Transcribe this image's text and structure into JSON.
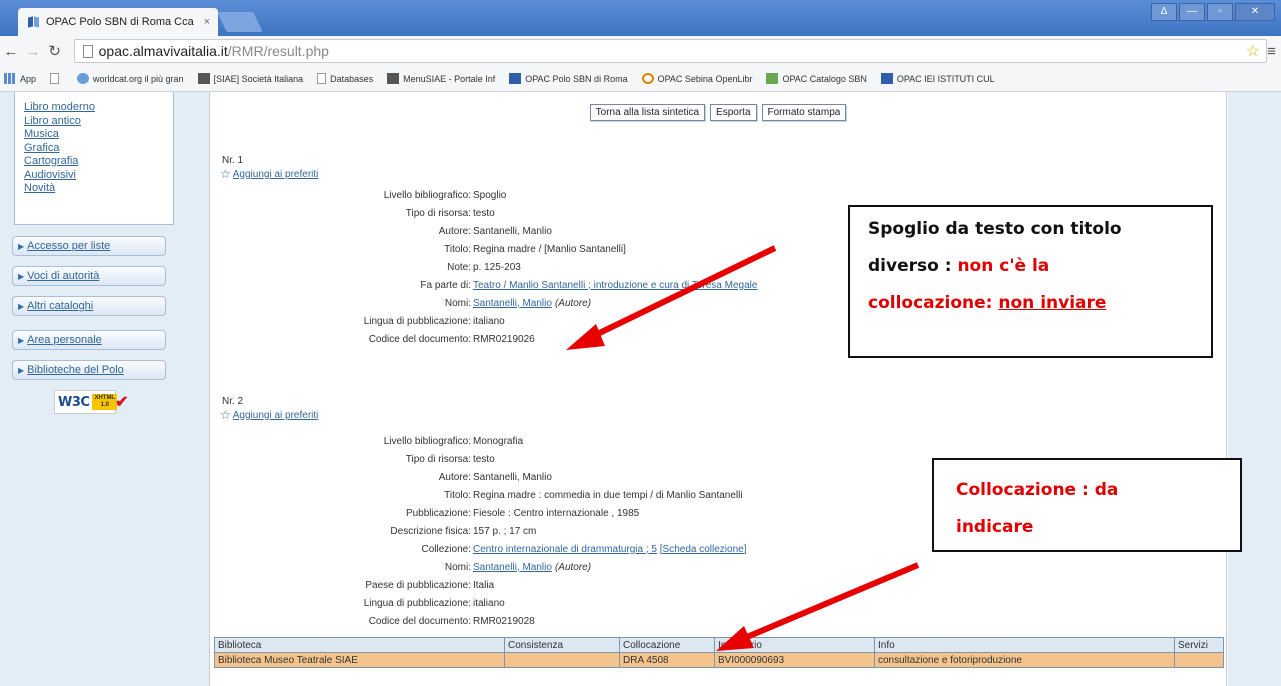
{
  "browser": {
    "tab_title": "OPAC Polo SBN di Roma Cca",
    "tab_close": "×",
    "url_host": "opac.almavivaitalia.it",
    "url_path": "/RMR/result.php",
    "window_controls": [
      "Δ",
      "—",
      "▫",
      "✕"
    ],
    "bookmarks": [
      "App",
      "",
      "worldcat.org il più gran",
      "[SIAE] Società Italiana",
      "Databases",
      "MenuSIAE - Portale Inf",
      "OPAC Polo SBN di Roma",
      "OPAC Sebina OpenLibr",
      "OPAC Catalogo SBN",
      "OPAC IEI ISTITUTI CUL"
    ]
  },
  "sidebar": {
    "links": [
      "Libro moderno",
      "Libro antico",
      "Musica",
      "Grafica",
      "Cartografia",
      "Audiovisivi",
      "Novità"
    ],
    "accordions": [
      "Accesso per liste",
      "Voci di autorità",
      "Altri cataloghi",
      "Area personale",
      "Biblioteche del Polo"
    ],
    "w3c": {
      "text": "W3C",
      "badge_line1": "XHTML",
      "badge_line2": "1.0"
    }
  },
  "toolbar": {
    "back_label": "Torna alla lista sintetica",
    "export_label": "Esporta",
    "print_label": "Formato stampa"
  },
  "records": [
    {
      "number": "Nr. 1",
      "fav_label": "Aggiungi ai preferiti",
      "fields": [
        {
          "k": "Livello bibliografico:",
          "v": "Spoglio"
        },
        {
          "k": "Tipo di risorsa:",
          "v": "testo"
        },
        {
          "k": "Autore:",
          "v": "Santanelli, Manlio"
        },
        {
          "k": "Titolo:",
          "v": "Regina madre / [Manlio Santanelli]"
        },
        {
          "k": "Note:",
          "v": "p. 125-203"
        },
        {
          "k": "Fa parte di:",
          "v": "Teatro / Manlio Santanelli ; introduzione e cura di Teresa Megale"
        },
        {
          "k": "Nomi:",
          "v": "Santanelli, Manlio",
          "role": "(Autore)"
        },
        {
          "k": "Lingua di pubblicazione:",
          "v": "italiano"
        },
        {
          "k": "Codice del documento:",
          "v": "RMR0219026"
        }
      ]
    },
    {
      "number": "Nr. 2",
      "fav_label": "Aggiungi ai preferiti",
      "fields": [
        {
          "k": "Livello bibliografico:",
          "v": "Monografia"
        },
        {
          "k": "Tipo di risorsa:",
          "v": "testo"
        },
        {
          "k": "Autore:",
          "v": "Santanelli, Manlio"
        },
        {
          "k": "Titolo:",
          "v": "Regina madre : commedia in due tempi / di Manlio Santanelli"
        },
        {
          "k": "Pubblicazione:",
          "v": "Fiesole : Centro internazionale , 1985"
        },
        {
          "k": "Descrizione fisica:",
          "v": "157 p. ; 17 cm"
        },
        {
          "k": "Collezione:",
          "v": "Centro internazionale di drammaturgia ; 5",
          "extra": "[Scheda collezione]"
        },
        {
          "k": "Nomi:",
          "v": "Santanelli, Manlio",
          "role": "(Autore)"
        },
        {
          "k": "Paese di pubblicazione:",
          "v": "Italia"
        },
        {
          "k": "Lingua di pubblicazione:",
          "v": "italiano"
        },
        {
          "k": "Codice del documento:",
          "v": "RMR0219028"
        }
      ]
    }
  ],
  "holdings": {
    "headers": [
      "Biblioteca",
      "Consistenza",
      "Collocazione",
      "Inventario",
      "Info",
      "Servizi"
    ],
    "rows": [
      [
        "Biblioteca Museo Teatrale SIAE",
        "",
        "DRA 4508",
        "BVI000090693",
        "consultazione e fotoriproduzione",
        ""
      ]
    ]
  },
  "annotations": {
    "callout1": {
      "line1": "Spoglio da testo con titolo",
      "line2a": "diverso : ",
      "line2b": "non c'è la",
      "line3a": "collocazione: ",
      "line3b": "non inviare"
    },
    "callout2": {
      "line1": "Collocazione : da",
      "line2": "indicare"
    },
    "arrow_color": "#e60000"
  }
}
